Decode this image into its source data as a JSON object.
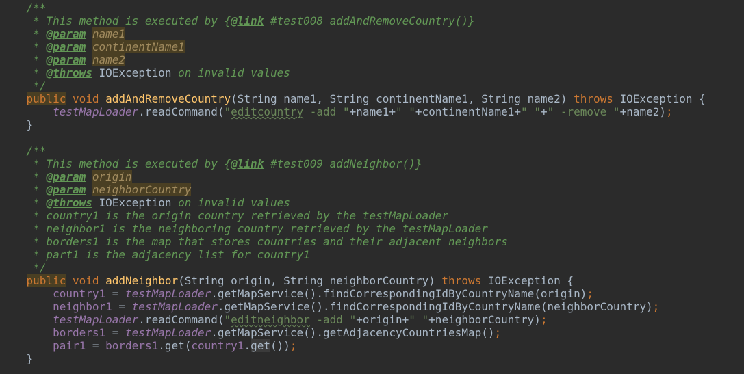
{
  "lines": [
    [
      {
        "t": "    /**",
        "c": "cm"
      }
    ],
    [
      {
        "t": "     * This method is executed by {",
        "c": "cm"
      },
      {
        "t": "@link",
        "c": "tag"
      },
      {
        "t": " #test008_addAndRemoveCountry()}",
        "c": "cm"
      }
    ],
    [
      {
        "t": "     * ",
        "c": "cm"
      },
      {
        "t": "@param",
        "c": "tag"
      },
      {
        "t": " ",
        "c": "cm"
      },
      {
        "t": "name1",
        "c": "pv"
      }
    ],
    [
      {
        "t": "     * ",
        "c": "cm"
      },
      {
        "t": "@param",
        "c": "tag"
      },
      {
        "t": " ",
        "c": "cm"
      },
      {
        "t": "continentName1",
        "c": "pv"
      }
    ],
    [
      {
        "t": "     * ",
        "c": "cm"
      },
      {
        "t": "@param",
        "c": "tag"
      },
      {
        "t": " ",
        "c": "cm"
      },
      {
        "t": "name2",
        "c": "pv"
      }
    ],
    [
      {
        "t": "     * ",
        "c": "cm"
      },
      {
        "t": "@throws",
        "c": "tag"
      },
      {
        "t": " ",
        "c": "cm"
      },
      {
        "t": "IOException",
        "c": "plain"
      },
      {
        "t": " on invalid values",
        "c": "cm"
      }
    ],
    [
      {
        "t": "     */",
        "c": "cm"
      }
    ],
    [
      {
        "t": "    ",
        "c": "plain"
      },
      {
        "t": "public",
        "c": "kwbg"
      },
      {
        "t": " ",
        "c": "plain"
      },
      {
        "t": "void",
        "c": "kw"
      },
      {
        "t": " ",
        "c": "plain"
      },
      {
        "t": "addAndRemoveCountry",
        "c": "fn"
      },
      {
        "t": "(String name1, String continentName1, String name2) ",
        "c": "plain"
      },
      {
        "t": "throws",
        "c": "kw"
      },
      {
        "t": " IOException {",
        "c": "plain"
      }
    ],
    [
      {
        "t": "        ",
        "c": "plain"
      },
      {
        "t": "testMapLoader",
        "c": "fld"
      },
      {
        "t": ".readCommand(",
        "c": "plain"
      },
      {
        "t": "\"",
        "c": "str"
      },
      {
        "t": "editcountry",
        "c": "str wavy"
      },
      {
        "t": " -add \"",
        "c": "str"
      },
      {
        "t": "+name1+",
        "c": "plain"
      },
      {
        "t": "\" \"",
        "c": "str"
      },
      {
        "t": "+continentName1+",
        "c": "plain"
      },
      {
        "t": "\" \"",
        "c": "str"
      },
      {
        "t": "+",
        "c": "plain"
      },
      {
        "t": "\" -remove \"",
        "c": "str"
      },
      {
        "t": "+name2)",
        "c": "plain"
      },
      {
        "t": ";",
        "c": "kw"
      }
    ],
    [
      {
        "t": "    }",
        "c": "plain"
      }
    ],
    [
      {
        "t": "",
        "c": "plain"
      }
    ],
    [
      {
        "t": "    /**",
        "c": "cm"
      }
    ],
    [
      {
        "t": "     * This method is executed by {",
        "c": "cm"
      },
      {
        "t": "@link",
        "c": "tag"
      },
      {
        "t": " #test009_addNeighbor()}",
        "c": "cm"
      }
    ],
    [
      {
        "t": "     * ",
        "c": "cm"
      },
      {
        "t": "@param",
        "c": "tag"
      },
      {
        "t": " ",
        "c": "cm"
      },
      {
        "t": "origin",
        "c": "pv"
      }
    ],
    [
      {
        "t": "     * ",
        "c": "cm"
      },
      {
        "t": "@param",
        "c": "tag"
      },
      {
        "t": " ",
        "c": "cm"
      },
      {
        "t": "neighborCountry",
        "c": "pv"
      }
    ],
    [
      {
        "t": "     * ",
        "c": "cm"
      },
      {
        "t": "@throws",
        "c": "tag"
      },
      {
        "t": " ",
        "c": "cm"
      },
      {
        "t": "IOException",
        "c": "plain"
      },
      {
        "t": " on invalid values",
        "c": "cm"
      }
    ],
    [
      {
        "t": "     * country1 is the origin country retrieved by the testMapLoader",
        "c": "cm"
      }
    ],
    [
      {
        "t": "     * neighbor1 is the neighboring country retrieved by the testMapLoader",
        "c": "cm"
      }
    ],
    [
      {
        "t": "     * borders1 is the map that stores countries and their adjacent neighbors",
        "c": "cm"
      }
    ],
    [
      {
        "t": "     * part1 is the adjacency list for country1",
        "c": "cm"
      }
    ],
    [
      {
        "t": "     */",
        "c": "cm"
      }
    ],
    [
      {
        "t": "    ",
        "c": "plain"
      },
      {
        "t": "public",
        "c": "kwbg"
      },
      {
        "t": " ",
        "c": "plain"
      },
      {
        "t": "void",
        "c": "kw"
      },
      {
        "t": " ",
        "c": "plain"
      },
      {
        "t": "addNeighbor",
        "c": "fn"
      },
      {
        "t": "(String origin, String neighborCountry) ",
        "c": "plain"
      },
      {
        "t": "throws",
        "c": "kw"
      },
      {
        "t": " IOException {",
        "c": "plain"
      }
    ],
    [
      {
        "t": "        ",
        "c": "plain"
      },
      {
        "t": "country1",
        "c": "var"
      },
      {
        "t": " = ",
        "c": "plain"
      },
      {
        "t": "testMapLoader",
        "c": "fld"
      },
      {
        "t": ".getMapService().findCorrespondingIdByCountryName(origin)",
        "c": "plain"
      },
      {
        "t": ";",
        "c": "kw"
      }
    ],
    [
      {
        "t": "        ",
        "c": "plain"
      },
      {
        "t": "neighbor1",
        "c": "var"
      },
      {
        "t": " = ",
        "c": "plain"
      },
      {
        "t": "testMapLoader",
        "c": "fld"
      },
      {
        "t": ".getMapService().findCorrespondingIdByCountryName(neighborCountry)",
        "c": "plain"
      },
      {
        "t": ";",
        "c": "kw"
      }
    ],
    [
      {
        "t": "        ",
        "c": "plain"
      },
      {
        "t": "testMapLoader",
        "c": "fld"
      },
      {
        "t": ".readCommand(",
        "c": "plain"
      },
      {
        "t": "\"",
        "c": "str"
      },
      {
        "t": "editneighbor",
        "c": "str wavy"
      },
      {
        "t": " -add \"",
        "c": "str"
      },
      {
        "t": "+origin+",
        "c": "plain"
      },
      {
        "t": "\" \"",
        "c": "str"
      },
      {
        "t": "+neighborCountry)",
        "c": "plain"
      },
      {
        "t": ";",
        "c": "kw"
      }
    ],
    [
      {
        "t": "        ",
        "c": "plain"
      },
      {
        "t": "borders1",
        "c": "var"
      },
      {
        "t": " = ",
        "c": "plain"
      },
      {
        "t": "testMapLoader",
        "c": "fld"
      },
      {
        "t": ".getMapService().getAdjacencyCountriesMap()",
        "c": "plain"
      },
      {
        "t": ";",
        "c": "kw"
      }
    ],
    [
      {
        "t": "        ",
        "c": "plain"
      },
      {
        "t": "pair1",
        "c": "var"
      },
      {
        "t": " = ",
        "c": "plain"
      },
      {
        "t": "borders1",
        "c": "var"
      },
      {
        "t": ".get(",
        "c": "plain"
      },
      {
        "t": "country1",
        "c": "var"
      },
      {
        "t": ".",
        "c": "plain"
      },
      {
        "t": "get",
        "c": "plain hl"
      },
      {
        "t": "())",
        "c": "plain"
      },
      {
        "t": ";",
        "c": "kw"
      }
    ],
    [
      {
        "t": "    }",
        "c": "plain"
      }
    ]
  ],
  "colors": {
    "background": "#2b2b2b",
    "comment": "#629755",
    "keyword": "#cc7832",
    "method": "#ffc66d",
    "field": "#9876aa",
    "string": "#6a8759",
    "plain": "#a9b7c6",
    "param_highlight": "#4a3f23"
  }
}
